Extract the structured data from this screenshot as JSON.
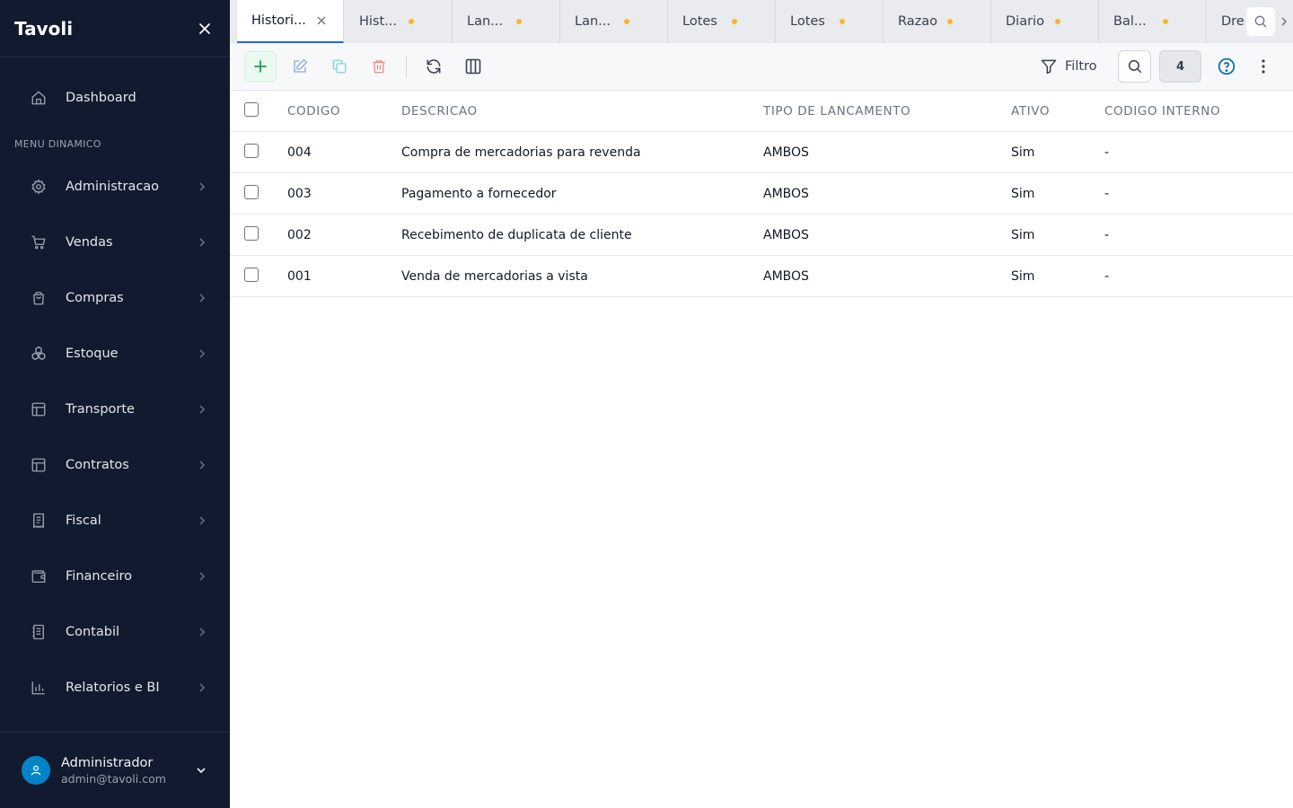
{
  "app": {
    "brand": "Tavoli"
  },
  "sidebar": {
    "dashboard": "Dashboard",
    "section_label": "MENU DINAMICO",
    "items": [
      {
        "label": "Administracao",
        "icon": "gear-icon"
      },
      {
        "label": "Vendas",
        "icon": "cart-icon"
      },
      {
        "label": "Compras",
        "icon": "shopping-bag-icon"
      },
      {
        "label": "Estoque",
        "icon": "boxes-icon"
      },
      {
        "label": "Transporte",
        "icon": "layout-icon"
      },
      {
        "label": "Contratos",
        "icon": "layout-icon"
      },
      {
        "label": "Fiscal",
        "icon": "receipt-icon"
      },
      {
        "label": "Financeiro",
        "icon": "wallet-icon"
      },
      {
        "label": "Contabil",
        "icon": "notebook-icon"
      },
      {
        "label": "Relatorios e BI",
        "icon": "bar-chart-icon"
      }
    ],
    "user": {
      "name": "Administrador",
      "email": "admin@tavoli.com"
    }
  },
  "tabs": [
    {
      "label": "Histori...",
      "active": true
    },
    {
      "label": "Hist...",
      "unsaved": true
    },
    {
      "label": "Lan...",
      "unsaved": true
    },
    {
      "label": "Lan...",
      "unsaved": true
    },
    {
      "label": "Lotes",
      "unsaved": true
    },
    {
      "label": "Lotes",
      "unsaved": true
    },
    {
      "label": "Razao",
      "unsaved": true
    },
    {
      "label": "Diario",
      "unsaved": true
    },
    {
      "label": "Bal...",
      "unsaved": true
    },
    {
      "label": "Dre"
    }
  ],
  "toolbar": {
    "filter_label": "Filtro",
    "record_count": "4"
  },
  "table": {
    "columns": [
      "CODIGO",
      "DESCRICAO",
      "TIPO DE LANCAMENTO",
      "ATIVO",
      "CODIGO INTERNO"
    ],
    "rows": [
      {
        "codigo": "004",
        "descricao": "Compra de mercadorias para revenda",
        "tipo": "AMBOS",
        "ativo": "Sim",
        "codigo_interno": "-"
      },
      {
        "codigo": "003",
        "descricao": "Pagamento a fornecedor",
        "tipo": "AMBOS",
        "ativo": "Sim",
        "codigo_interno": "-"
      },
      {
        "codigo": "002",
        "descricao": "Recebimento de duplicata de cliente",
        "tipo": "AMBOS",
        "ativo": "Sim",
        "codigo_interno": "-"
      },
      {
        "codigo": "001",
        "descricao": "Venda de mercadorias a vista",
        "tipo": "AMBOS",
        "ativo": "Sim",
        "codigo_interno": "-"
      }
    ]
  },
  "colors": {
    "sidebar_bg": "#111a2e",
    "accent": "#2563eb",
    "unsaved_dot": "#f5b82e",
    "add_green": "#16a34a",
    "delete_red": "#ef4444",
    "avatar_bg": "#0284c7"
  }
}
